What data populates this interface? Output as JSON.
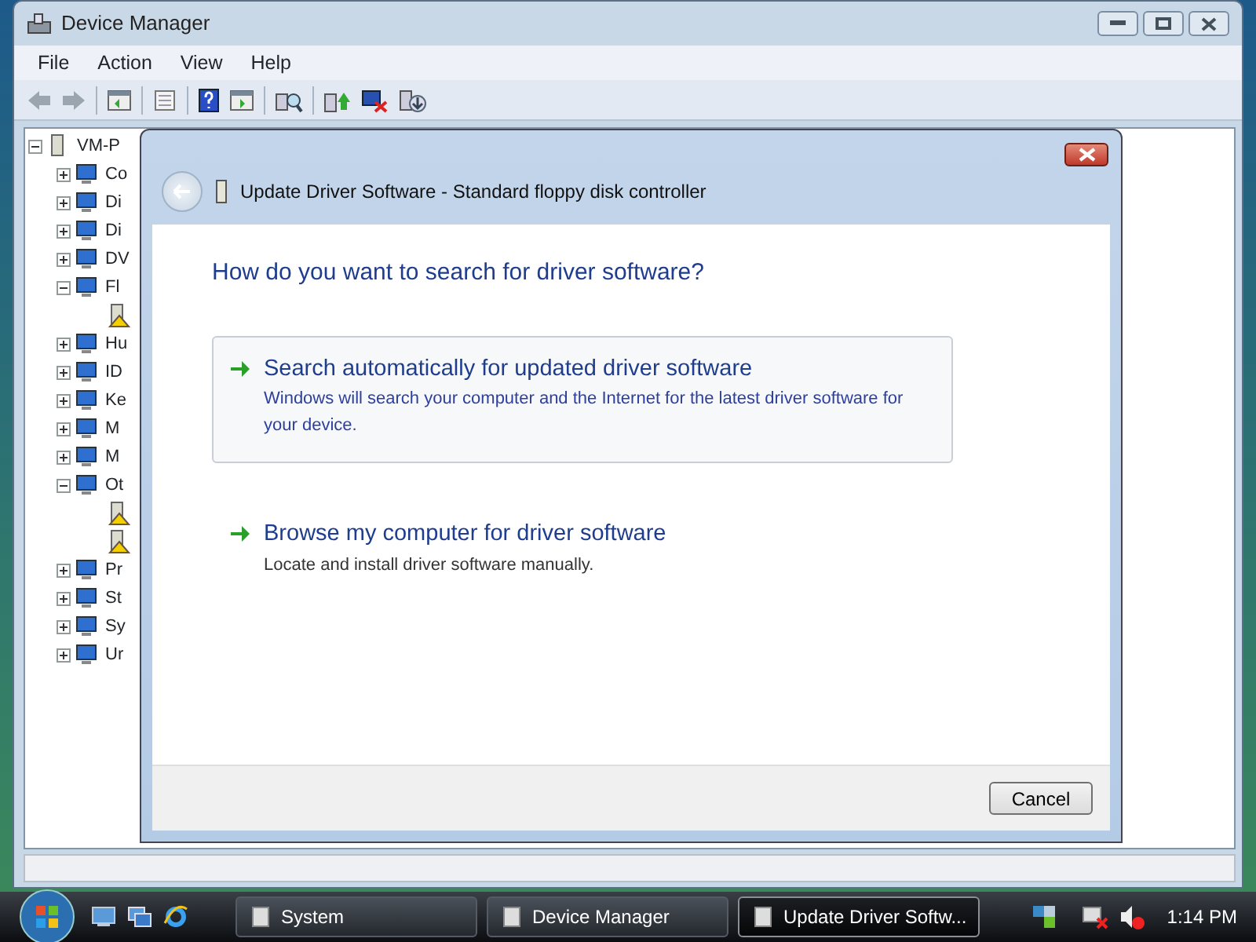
{
  "window": {
    "title": "Device Manager"
  },
  "menu": [
    "File",
    "Action",
    "View",
    "Help"
  ],
  "tree": {
    "label": "VM-P",
    "expanded": true,
    "children": [
      {
        "label": "Co",
        "expanded": false
      },
      {
        "label": "Di",
        "expanded": false
      },
      {
        "label": "Di",
        "expanded": false
      },
      {
        "label": "DV",
        "expanded": false
      },
      {
        "label": "Fl",
        "expanded": true,
        "children": [
          {
            "warning": true
          }
        ]
      },
      {
        "label": "Hu",
        "expanded": false
      },
      {
        "label": "ID",
        "expanded": false
      },
      {
        "label": "Ke",
        "expanded": false
      },
      {
        "label": "M",
        "expanded": false
      },
      {
        "label": "M",
        "expanded": false
      },
      {
        "label": "Ot",
        "expanded": true,
        "children": [
          {
            "warning": true
          },
          {
            "warning": true
          }
        ]
      },
      {
        "label": "Pr",
        "expanded": false
      },
      {
        "label": "St",
        "expanded": false
      },
      {
        "label": "Sy",
        "expanded": false
      },
      {
        "label": "Ur",
        "expanded": false
      }
    ]
  },
  "dialog": {
    "title": "Update Driver Software - Standard floppy disk controller",
    "heading": "How do you want to search for driver software?",
    "options": [
      {
        "title": "Search automatically for updated driver software",
        "description": "Windows will search your computer and the Internet for the latest driver software for your device.",
        "hovered": true
      },
      {
        "title": "Browse my computer for driver software",
        "description": "Locate and install driver software manually.",
        "hovered": false
      }
    ],
    "buttons": [
      "Cancel"
    ]
  },
  "taskbar": {
    "buttons": [
      {
        "label": "System",
        "selected": false
      },
      {
        "label": "Device Manager",
        "selected": false
      },
      {
        "label": "Update Driver Softw...",
        "selected": true
      }
    ],
    "clock": "1:14 PM"
  }
}
